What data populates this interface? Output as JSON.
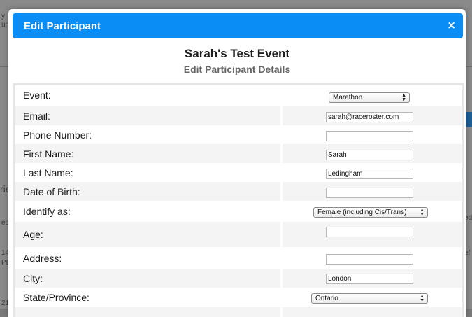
{
  "modal": {
    "title": "Edit Participant",
    "close_glyph": "×",
    "event_name": "Sarah's Test Event",
    "subtitle": "Edit Participant Details"
  },
  "fields": {
    "event": {
      "label": "Event:",
      "value": "Marathon"
    },
    "email": {
      "label": "Email:",
      "value": "sarah@raceroster.com"
    },
    "phone": {
      "label": "Phone Number:",
      "value": ""
    },
    "first_name": {
      "label": "First Name:",
      "value": "Sarah"
    },
    "last_name": {
      "label": "Last Name:",
      "value": "Ledingham"
    },
    "dob": {
      "label": "Date of Birth:",
      "value": ""
    },
    "identify": {
      "label": "Identify as:",
      "value": "Female (including Cis/Trans)"
    },
    "age": {
      "label": "Age:",
      "value": ""
    },
    "address": {
      "label": "Address:",
      "value": ""
    },
    "city": {
      "label": "City:",
      "value": "London"
    },
    "state": {
      "label": "State/Province:",
      "value": "Ontario"
    }
  },
  "background": {
    "fragments": [
      "y",
      "und",
      "ed",
      "rie",
      "14",
      "PD",
      "21",
      "ed",
      "ef"
    ]
  },
  "colors": {
    "header_blue": "#0a8df5",
    "row_shade": "#f4f4f4"
  }
}
